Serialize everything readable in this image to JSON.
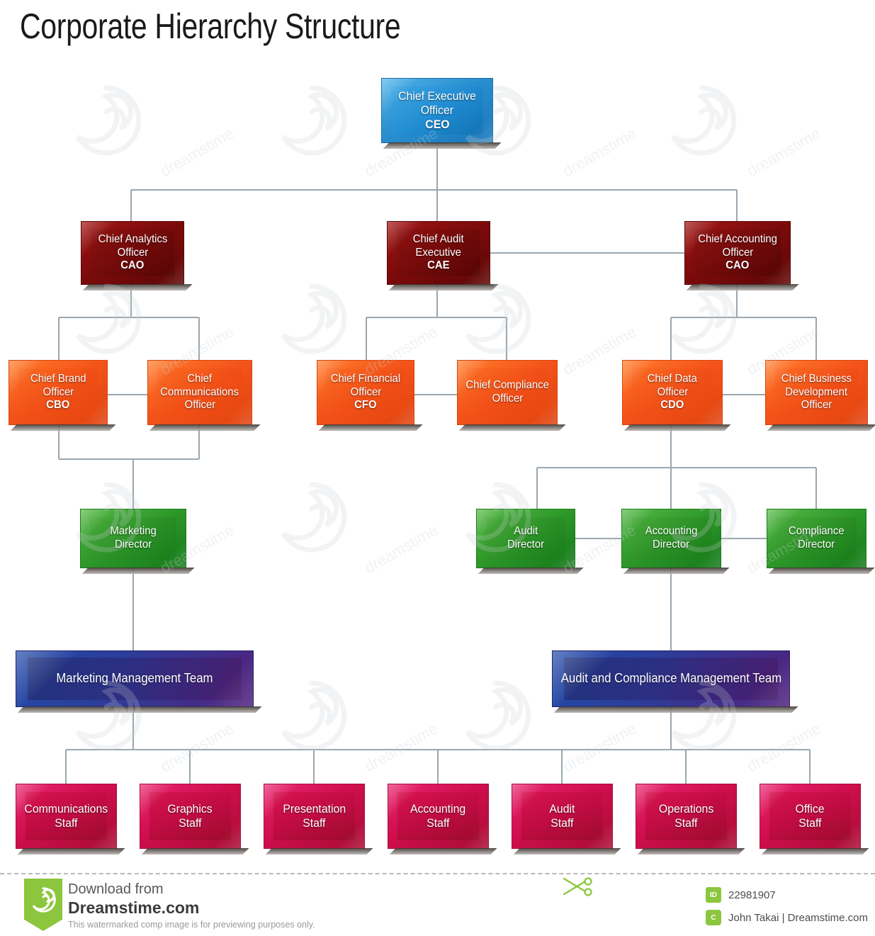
{
  "title": "Corporate Hierarchy Structure",
  "chart_data": {
    "type": "diagram",
    "diagram_type": "organizational-chart",
    "title": "Corporate Hierarchy Structure",
    "levels": [
      {
        "level": 1,
        "color": "#2a8fd0",
        "color_name": "blue",
        "nodes": [
          {
            "id": "ceo",
            "line1": "Chief Executive",
            "line2": "Officer",
            "abbr": "CEO"
          }
        ]
      },
      {
        "level": 2,
        "color": "#7d0b0b",
        "color_name": "dark-red",
        "nodes": [
          {
            "id": "cao_analytics",
            "line1": "Chief Analytics",
            "line2": "Officer",
            "abbr": "CAO"
          },
          {
            "id": "cae",
            "line1": "Chief Audit",
            "line2": "Executive",
            "abbr": "CAE"
          },
          {
            "id": "cao_accounting",
            "line1": "Chief Accounting",
            "line2": "Officer",
            "abbr": "CAO"
          }
        ]
      },
      {
        "level": 3,
        "color": "#f4541a",
        "color_name": "orange",
        "nodes": [
          {
            "id": "cbo",
            "line1": "Chief Brand",
            "line2": "Officer",
            "abbr": "CBO"
          },
          {
            "id": "cco",
            "line1": "Chief",
            "line2": "Communications",
            "line3": "Officer",
            "abbr": ""
          },
          {
            "id": "cfo",
            "line1": "Chief Financial",
            "line2": "Officer",
            "abbr": "CFO"
          },
          {
            "id": "ccomp",
            "line1": "Chief Compliance",
            "line2": "Officer",
            "abbr": ""
          },
          {
            "id": "cdo",
            "line1": "Chief Data",
            "line2": "Officer",
            "abbr": "CDO"
          },
          {
            "id": "cbdo",
            "line1": "Chief Business",
            "line2": "Development",
            "line3": "Officer",
            "abbr": ""
          }
        ]
      },
      {
        "level": 4,
        "color": "#2f9a2a",
        "color_name": "green",
        "nodes": [
          {
            "id": "dir_marketing",
            "line1": "Marketing",
            "line2": "Director",
            "abbr": ""
          },
          {
            "id": "dir_audit",
            "line1": "Audit",
            "line2": "Director",
            "abbr": ""
          },
          {
            "id": "dir_accounting",
            "line1": "Accounting",
            "line2": "Director",
            "abbr": ""
          },
          {
            "id": "dir_compliance",
            "line1": "Compliance",
            "line2": "Director",
            "abbr": ""
          }
        ]
      },
      {
        "level": 5,
        "color": "#2a3f9b",
        "color_name": "navy-purple",
        "nodes": [
          {
            "id": "team_marketing",
            "line1": "Marketing Management Team",
            "line2": "",
            "abbr": ""
          },
          {
            "id": "team_audit",
            "line1": "Audit and Compliance Management Team",
            "line2": "",
            "abbr": ""
          }
        ]
      },
      {
        "level": 6,
        "color": "#cf0e4e",
        "color_name": "pink",
        "nodes": [
          {
            "id": "staff_comm",
            "line1": "Communications",
            "line2": "Staff",
            "abbr": ""
          },
          {
            "id": "staff_graphics",
            "line1": "Graphics",
            "line2": "Staff",
            "abbr": ""
          },
          {
            "id": "staff_presentation",
            "line1": "Presentation",
            "line2": "Staff",
            "abbr": ""
          },
          {
            "id": "staff_accounting",
            "line1": "Accounting",
            "line2": "Staff",
            "abbr": ""
          },
          {
            "id": "staff_audit",
            "line1": "Audit",
            "line2": "Staff",
            "abbr": ""
          },
          {
            "id": "staff_operations",
            "line1": "Operations",
            "line2": "Staff",
            "abbr": ""
          },
          {
            "id": "staff_office",
            "line1": "Office",
            "line2": "Staff",
            "abbr": ""
          }
        ]
      }
    ],
    "connector_color": "#9aa7b0"
  },
  "footer": {
    "download_from": "Download from",
    "site": "Dreamstime.com",
    "disclaimer": "This watermarked comp image is for previewing purposes only.",
    "id_chip": "ID",
    "id_value": "22981907",
    "author_chip": "C",
    "author_value": "John Takai | Dreamstime.com"
  },
  "watermark": {
    "text": "dreamstime"
  }
}
